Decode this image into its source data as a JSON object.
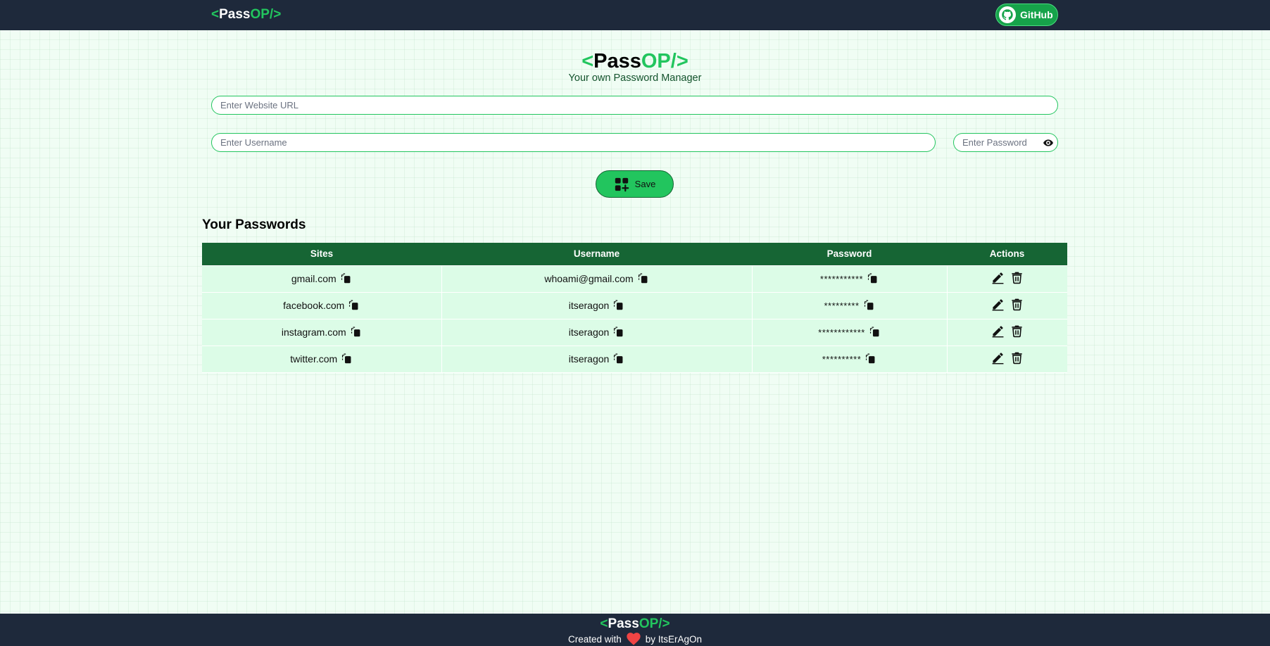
{
  "brand": {
    "lt": "<",
    "pass": "Pass",
    "op": "OP/",
    "gt": ">"
  },
  "nav": {
    "github_label": "GitHub"
  },
  "header": {
    "subtitle": "Your own Password Manager"
  },
  "form": {
    "url_placeholder": "Enter Website URL",
    "username_placeholder": "Enter Username",
    "password_placeholder": "Enter Password",
    "save_label": "Save"
  },
  "passwords": {
    "title": "Your Passwords",
    "columns": [
      "Sites",
      "Username",
      "Password",
      "Actions"
    ],
    "rows": [
      {
        "site": "gmail.com",
        "username": "whoami@gmail.com",
        "password": "***********"
      },
      {
        "site": "facebook.com",
        "username": "itseragon",
        "password": "*********"
      },
      {
        "site": "instagram.com",
        "username": "itseragon",
        "password": "************"
      },
      {
        "site": "twitter.com",
        "username": "itseragon",
        "password": "**********"
      }
    ]
  },
  "footer": {
    "created_with": "Created with",
    "by": "by ItsErAgOn"
  },
  "colors": {
    "nav_bg": "#1e293b",
    "accent": "#22c55e",
    "table_header": "#166534",
    "row_bg": "#dcfce7",
    "heart": "#ef4444"
  },
  "icons": [
    "github-icon",
    "eye-icon",
    "add-grid-icon",
    "copy-icon",
    "edit-icon",
    "delete-icon",
    "heart-icon"
  ]
}
